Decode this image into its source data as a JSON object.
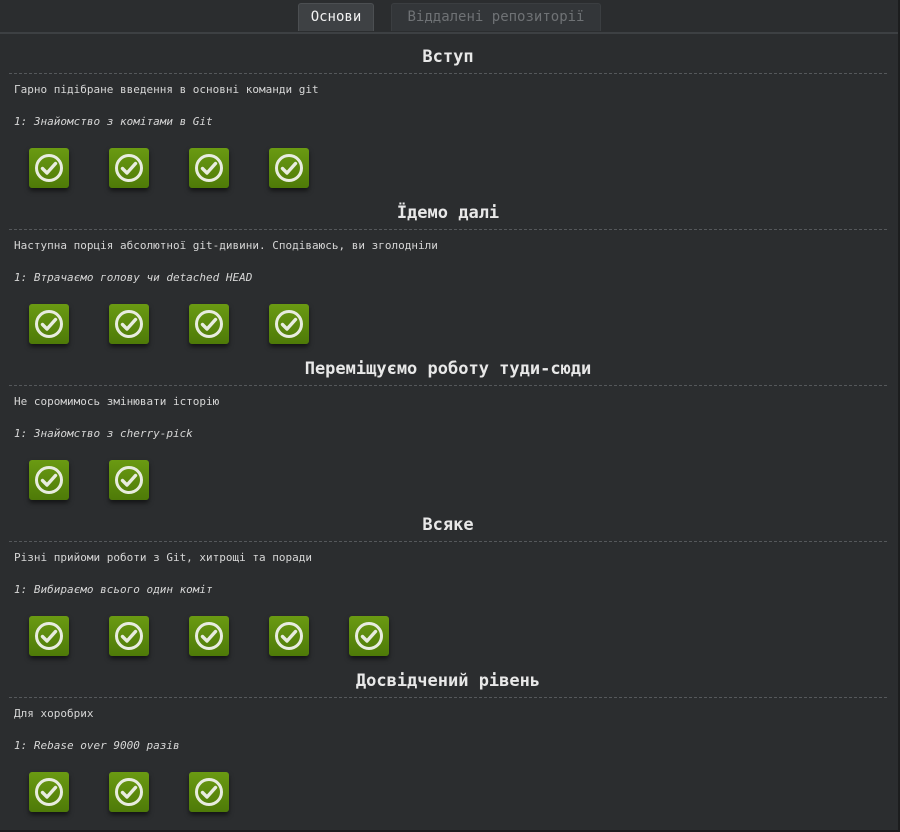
{
  "tabs": [
    {
      "label": "Основи",
      "active": true
    },
    {
      "label": "Віддалені репозиторії",
      "active": false
    }
  ],
  "colors": {
    "background": "#2b2d2f",
    "level_complete": "#5a8a0c",
    "check": "#e8ecdf"
  },
  "sections": [
    {
      "title": "Вступ",
      "description": "Гарно підібране введення в основні команди git",
      "subtitle": "1: Знайомство з комітами в Git",
      "levels": [
        "check-icon",
        "check-icon",
        "check-icon",
        "check-icon"
      ]
    },
    {
      "title": "Їдемо далі",
      "description": "Наступна порція абсолютної git-дивини. Сподіваюсь, ви зголодніли",
      "subtitle": "1: Втрачаємо голову чи detached HEAD",
      "levels": [
        "check-icon",
        "check-icon",
        "check-icon",
        "check-icon"
      ]
    },
    {
      "title": "Переміщуємо роботу туди-сюди",
      "description": "Не соромимось змінювати історію",
      "subtitle": "1: Знайомство з cherry-pick",
      "levels": [
        "check-icon",
        "check-icon"
      ]
    },
    {
      "title": "Всяке",
      "description": "Різні прийоми роботи з Git, хитрощі та поради",
      "subtitle": "1: Вибираємо всього один коміт",
      "levels": [
        "check-icon",
        "check-icon",
        "check-icon",
        "check-icon",
        "check-icon"
      ]
    },
    {
      "title": "Досвідчений рівень",
      "description": "Для хоробрих",
      "subtitle": "1: Rebase over 9000 разів",
      "levels": [
        "check-icon",
        "check-icon",
        "check-icon"
      ]
    }
  ]
}
